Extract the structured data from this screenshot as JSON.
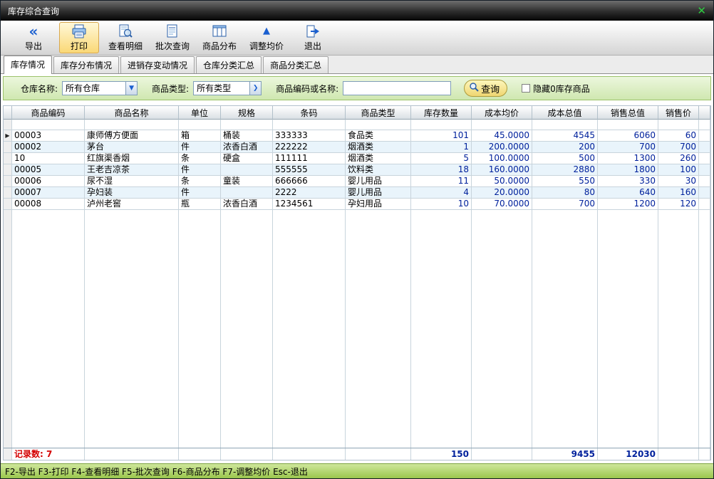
{
  "window": {
    "title": "库存综合查询",
    "close_glyph": "✕"
  },
  "toolbar": {
    "items": [
      {
        "label": "导出",
        "icon": "export-icon"
      },
      {
        "label": "打印",
        "icon": "print-icon",
        "active": true
      },
      {
        "label": "查看明细",
        "icon": "view-detail-icon"
      },
      {
        "label": "批次查询",
        "icon": "batch-query-icon"
      },
      {
        "label": "商品分布",
        "icon": "distribution-icon"
      },
      {
        "label": "调整均价",
        "icon": "adjust-price-icon"
      },
      {
        "label": "退出",
        "icon": "exit-icon"
      }
    ]
  },
  "tabs": [
    {
      "label": "库存情况",
      "active": true
    },
    {
      "label": "库存分布情况",
      "active": false
    },
    {
      "label": "进销存变动情况",
      "active": false
    },
    {
      "label": "仓库分类汇总",
      "active": false
    },
    {
      "label": "商品分类汇总",
      "active": false
    }
  ],
  "filter": {
    "warehouse_label": "仓库名称:",
    "warehouse_value": "所有仓库",
    "type_label": "商品类型:",
    "type_value": "所有类型",
    "keyword_label": "商品编码或名称:",
    "keyword_value": "",
    "query_label": "查询",
    "hide_zero_label": "隐藏0库存商品",
    "hide_zero_checked": false
  },
  "table": {
    "headers": [
      "商品编码",
      "商品名称",
      "单位",
      "规格",
      "条码",
      "商品类型",
      "库存数量",
      "成本均价",
      "成本总值",
      "销售总值",
      "销售价"
    ],
    "rows": [
      [
        "00003",
        "康师傅方便面",
        "箱",
        "桶装",
        "333333",
        "食品类",
        "101",
        "45.0000",
        "4545",
        "6060",
        "60"
      ],
      [
        "00002",
        "茅台",
        "件",
        "浓香白酒",
        "222222",
        "烟酒类",
        "1",
        "200.0000",
        "200",
        "700",
        "700"
      ],
      [
        "10",
        "红旗渠香烟",
        "条",
        "硬盒",
        "111111",
        "烟酒类",
        "5",
        "100.0000",
        "500",
        "1300",
        "260"
      ],
      [
        "00005",
        "王老吉凉茶",
        "件",
        "",
        "555555",
        "饮料类",
        "18",
        "160.0000",
        "2880",
        "1800",
        "100"
      ],
      [
        "00006",
        "尿不湿",
        "条",
        "童装",
        "666666",
        "婴儿用品",
        "11",
        "50.0000",
        "550",
        "330",
        "30"
      ],
      [
        "00007",
        "孕妇装",
        "件",
        "",
        "2222",
        "婴儿用品",
        "4",
        "20.0000",
        "80",
        "640",
        "160"
      ],
      [
        "00008",
        "泸州老窖",
        "瓶",
        "浓香白酒",
        "1234561",
        "孕妇用品",
        "10",
        "70.0000",
        "700",
        "1200",
        "120"
      ]
    ],
    "current_row_index": 0,
    "totals": {
      "records_label": "记录数:",
      "records_count": "7",
      "qty": "150",
      "cost_total": "9455",
      "sale_total": "12030"
    }
  },
  "statusbar": {
    "text": "F2-导出 F3-打印 F4-查看明细 F5-批次查询 F6-商品分布 F7-调整均价 Esc-退出"
  },
  "colors": {
    "icon_blue": "#1a5fd0",
    "totals_red": "#d40000",
    "totals_blue": "#0000d4",
    "filter_green": "#d9ecc0",
    "statusbar_green": "#9ac64c",
    "close_green": "#2ecc40",
    "active_button_yellow": "#fad876"
  }
}
